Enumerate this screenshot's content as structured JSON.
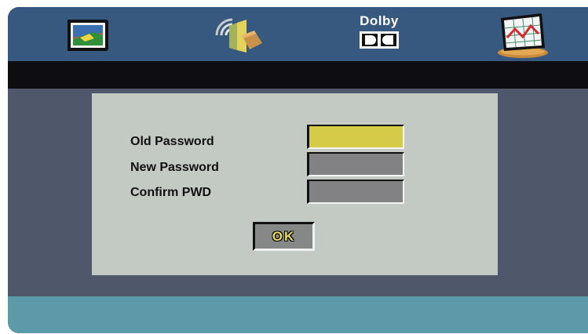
{
  "menu": {
    "tabs": [
      {
        "icon": "tv-picture-icon"
      },
      {
        "icon": "audio-speaker-icon"
      },
      {
        "icon": "dolby-icon",
        "label": "Dolby"
      },
      {
        "icon": "preference-chart-icon"
      }
    ]
  },
  "password_dialog": {
    "old_label": "Old Password",
    "new_label": "New Password",
    "confirm_label": "Confirm PWD",
    "old_value": "",
    "new_value": "",
    "confirm_value": "",
    "ok_label": "OK"
  },
  "colors": {
    "topbar": "#38597f",
    "subbar": "#0e0e12",
    "body": "#4e586a",
    "bottombar": "#5d9aa9",
    "dialog": "#c3c9c3",
    "highlight": "#d6cb48",
    "field": "#828284"
  }
}
